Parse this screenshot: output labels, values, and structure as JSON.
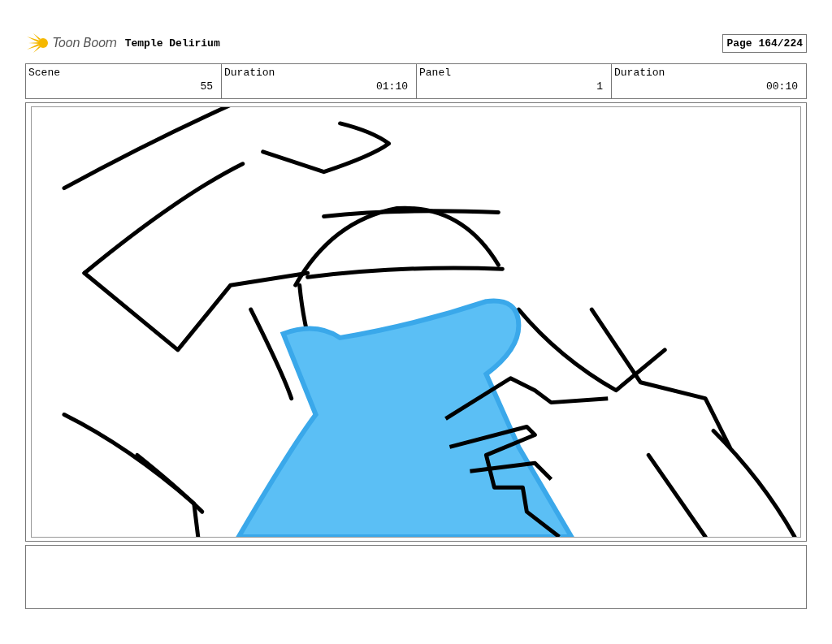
{
  "header": {
    "logo": "Toon Boom",
    "project_title": "Temple Delirium",
    "page": "Page 164/224"
  },
  "info": [
    {
      "label": "Scene",
      "value": "55"
    },
    {
      "label": "Duration",
      "value": "01:10"
    },
    {
      "label": "Panel",
      "value": "1"
    },
    {
      "label": "Duration",
      "value": "00:10"
    }
  ]
}
